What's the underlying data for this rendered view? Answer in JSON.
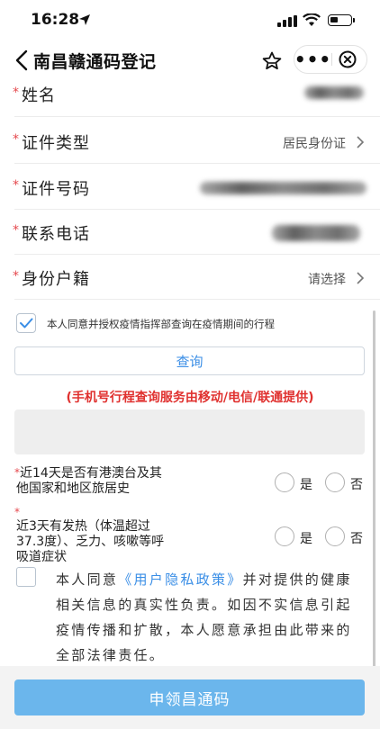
{
  "status_bar": {
    "time": "16:28"
  },
  "nav": {
    "title": "南昌赣通码登记",
    "more": "•••"
  },
  "form": {
    "required_mark": "*",
    "rows": [
      {
        "label": "姓名",
        "value": ""
      },
      {
        "label": "证件类型",
        "value": "居民身份证"
      },
      {
        "label": "证件号码",
        "value": ""
      },
      {
        "label": "联系电话",
        "value": ""
      },
      {
        "label": "身份户籍",
        "value": "请选择"
      }
    ]
  },
  "consent": {
    "text": "本人同意并授权疫情指挥部查询在疫情期间的行程",
    "checked": true
  },
  "query_button": "查询",
  "notice": "(手机号行程查询服务由移动/电信/联通提供)",
  "questions": [
    {
      "line1": "近14天是否有港澳台及其",
      "line2": "他国家和地区旅居史",
      "line3": ""
    },
    {
      "line1": "近3天有发热（体温超过",
      "line2": "37.3度）、乏力、咳嗽等呼",
      "line3": "吸道症状"
    }
  ],
  "radio_labels": {
    "yes": "是",
    "no": "否"
  },
  "agreement": {
    "prefix": "本人同意",
    "link": "《用户隐私政策》",
    "suffix": "并对提供的健康相关信息的真实性负责。如因不实信息引起疫情传播和扩散，本人愿意承担由此带来的全部法律责任。"
  },
  "submit_button": "申领昌通码",
  "colors": {
    "accent": "#3a8ee6",
    "required": "#e5484d",
    "notice": "#e0312f",
    "submit_bg": "#6bb6ec"
  }
}
